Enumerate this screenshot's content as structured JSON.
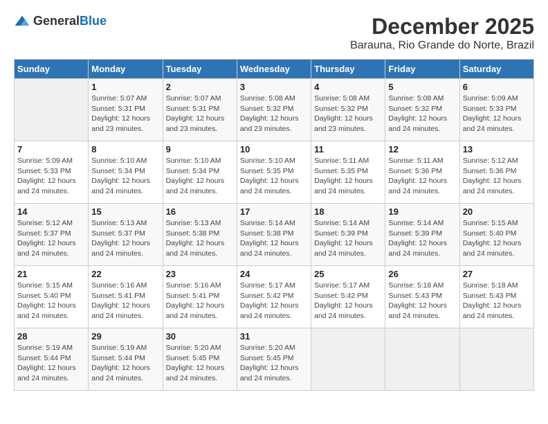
{
  "logo": {
    "text_general": "General",
    "text_blue": "Blue"
  },
  "title": "December 2025",
  "subtitle": "Barauna, Rio Grande do Norte, Brazil",
  "days_of_week": [
    "Sunday",
    "Monday",
    "Tuesday",
    "Wednesday",
    "Thursday",
    "Friday",
    "Saturday"
  ],
  "weeks": [
    [
      {
        "day": "",
        "info": ""
      },
      {
        "day": "1",
        "info": "Sunrise: 5:07 AM\nSunset: 5:31 PM\nDaylight: 12 hours\nand 23 minutes."
      },
      {
        "day": "2",
        "info": "Sunrise: 5:07 AM\nSunset: 5:31 PM\nDaylight: 12 hours\nand 23 minutes."
      },
      {
        "day": "3",
        "info": "Sunrise: 5:08 AM\nSunset: 5:32 PM\nDaylight: 12 hours\nand 23 minutes."
      },
      {
        "day": "4",
        "info": "Sunrise: 5:08 AM\nSunset: 5:32 PM\nDaylight: 12 hours\nand 23 minutes."
      },
      {
        "day": "5",
        "info": "Sunrise: 5:08 AM\nSunset: 5:32 PM\nDaylight: 12 hours\nand 24 minutes."
      },
      {
        "day": "6",
        "info": "Sunrise: 5:09 AM\nSunset: 5:33 PM\nDaylight: 12 hours\nand 24 minutes."
      }
    ],
    [
      {
        "day": "7",
        "info": "Sunrise: 5:09 AM\nSunset: 5:33 PM\nDaylight: 12 hours\nand 24 minutes."
      },
      {
        "day": "8",
        "info": "Sunrise: 5:10 AM\nSunset: 5:34 PM\nDaylight: 12 hours\nand 24 minutes."
      },
      {
        "day": "9",
        "info": "Sunrise: 5:10 AM\nSunset: 5:34 PM\nDaylight: 12 hours\nand 24 minutes."
      },
      {
        "day": "10",
        "info": "Sunrise: 5:10 AM\nSunset: 5:35 PM\nDaylight: 12 hours\nand 24 minutes."
      },
      {
        "day": "11",
        "info": "Sunrise: 5:11 AM\nSunset: 5:35 PM\nDaylight: 12 hours\nand 24 minutes."
      },
      {
        "day": "12",
        "info": "Sunrise: 5:11 AM\nSunset: 5:36 PM\nDaylight: 12 hours\nand 24 minutes."
      },
      {
        "day": "13",
        "info": "Sunrise: 5:12 AM\nSunset: 5:36 PM\nDaylight: 12 hours\nand 24 minutes."
      }
    ],
    [
      {
        "day": "14",
        "info": "Sunrise: 5:12 AM\nSunset: 5:37 PM\nDaylight: 12 hours\nand 24 minutes."
      },
      {
        "day": "15",
        "info": "Sunrise: 5:13 AM\nSunset: 5:37 PM\nDaylight: 12 hours\nand 24 minutes."
      },
      {
        "day": "16",
        "info": "Sunrise: 5:13 AM\nSunset: 5:38 PM\nDaylight: 12 hours\nand 24 minutes."
      },
      {
        "day": "17",
        "info": "Sunrise: 5:14 AM\nSunset: 5:38 PM\nDaylight: 12 hours\nand 24 minutes."
      },
      {
        "day": "18",
        "info": "Sunrise: 5:14 AM\nSunset: 5:39 PM\nDaylight: 12 hours\nand 24 minutes."
      },
      {
        "day": "19",
        "info": "Sunrise: 5:14 AM\nSunset: 5:39 PM\nDaylight: 12 hours\nand 24 minutes."
      },
      {
        "day": "20",
        "info": "Sunrise: 5:15 AM\nSunset: 5:40 PM\nDaylight: 12 hours\nand 24 minutes."
      }
    ],
    [
      {
        "day": "21",
        "info": "Sunrise: 5:15 AM\nSunset: 5:40 PM\nDaylight: 12 hours\nand 24 minutes."
      },
      {
        "day": "22",
        "info": "Sunrise: 5:16 AM\nSunset: 5:41 PM\nDaylight: 12 hours\nand 24 minutes."
      },
      {
        "day": "23",
        "info": "Sunrise: 5:16 AM\nSunset: 5:41 PM\nDaylight: 12 hours\nand 24 minutes."
      },
      {
        "day": "24",
        "info": "Sunrise: 5:17 AM\nSunset: 5:42 PM\nDaylight: 12 hours\nand 24 minutes."
      },
      {
        "day": "25",
        "info": "Sunrise: 5:17 AM\nSunset: 5:42 PM\nDaylight: 12 hours\nand 24 minutes."
      },
      {
        "day": "26",
        "info": "Sunrise: 5:18 AM\nSunset: 5:43 PM\nDaylight: 12 hours\nand 24 minutes."
      },
      {
        "day": "27",
        "info": "Sunrise: 5:18 AM\nSunset: 5:43 PM\nDaylight: 12 hours\nand 24 minutes."
      }
    ],
    [
      {
        "day": "28",
        "info": "Sunrise: 5:19 AM\nSunset: 5:44 PM\nDaylight: 12 hours\nand 24 minutes."
      },
      {
        "day": "29",
        "info": "Sunrise: 5:19 AM\nSunset: 5:44 PM\nDaylight: 12 hours\nand 24 minutes."
      },
      {
        "day": "30",
        "info": "Sunrise: 5:20 AM\nSunset: 5:45 PM\nDaylight: 12 hours\nand 24 minutes."
      },
      {
        "day": "31",
        "info": "Sunrise: 5:20 AM\nSunset: 5:45 PM\nDaylight: 12 hours\nand 24 minutes."
      },
      {
        "day": "",
        "info": ""
      },
      {
        "day": "",
        "info": ""
      },
      {
        "day": "",
        "info": ""
      }
    ]
  ]
}
